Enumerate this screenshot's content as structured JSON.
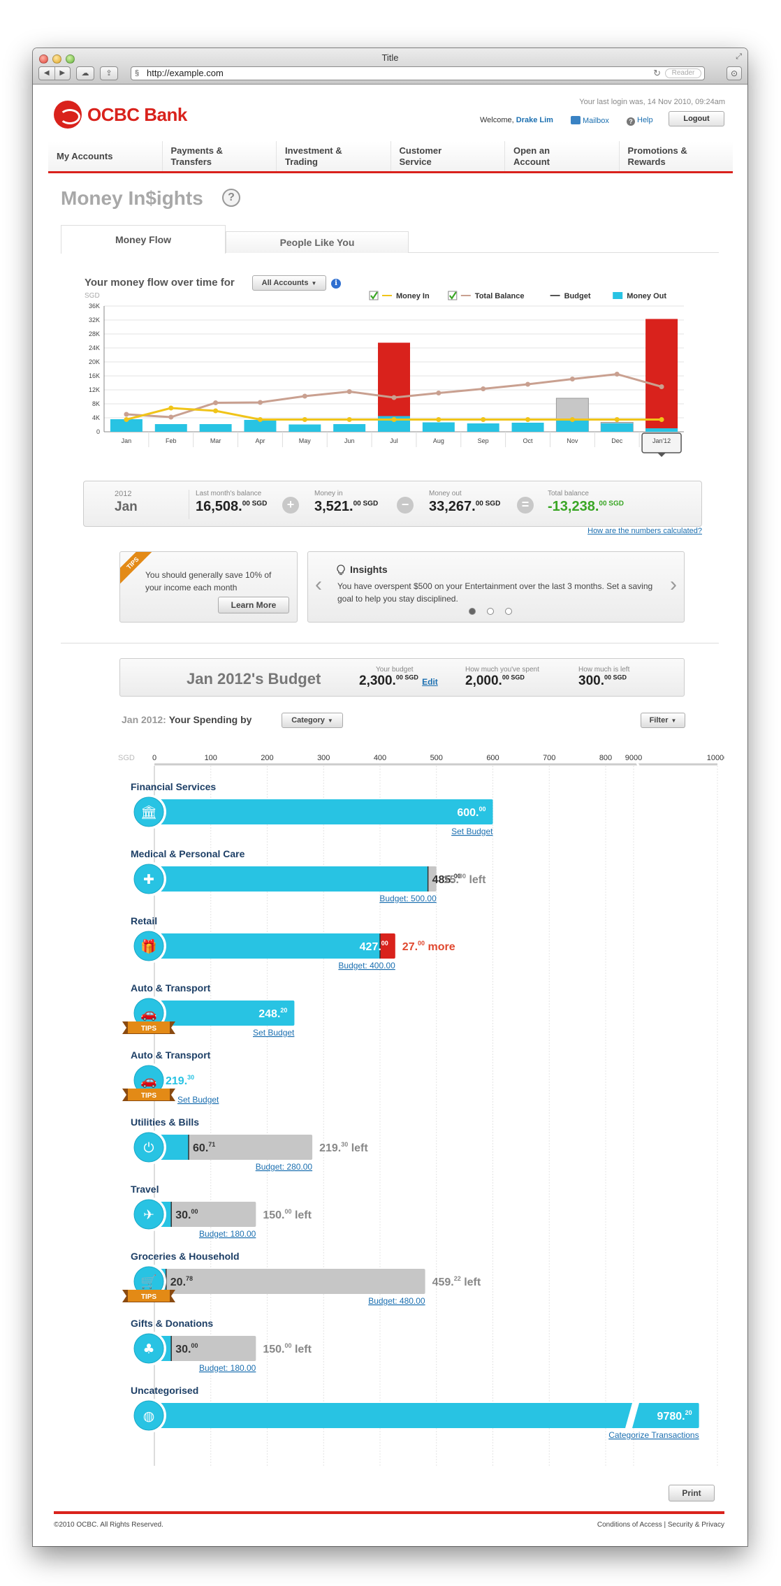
{
  "browser": {
    "title": "Title",
    "url": "http://example.com",
    "reader_label": "Reader"
  },
  "header": {
    "logo_text": "OCBC Bank",
    "last_login": "Your last login was, 14 Nov 2010, 09:24am",
    "welcome": "Welcome,",
    "user_name": "Drake Lim",
    "mailbox": "Mailbox",
    "help": "Help",
    "logout": "Logout"
  },
  "nav": [
    {
      "line1": "My Accounts",
      "line2": ""
    },
    {
      "line1": "Payments &",
      "line2": "Transfers"
    },
    {
      "line1": "Investment &",
      "line2": "Trading"
    },
    {
      "line1": "Customer",
      "line2": "Service"
    },
    {
      "line1": "Open an",
      "line2": "Account"
    },
    {
      "line1": "Promotions &",
      "line2": "Rewards"
    }
  ],
  "page": {
    "title": "Money In$ights",
    "help_symbol": "?",
    "tabs": [
      "Money Flow",
      "People Like You"
    ],
    "active_tab": 0
  },
  "flow": {
    "label": "Your money flow over time for",
    "account_filter": "All Accounts",
    "info_symbol": "i",
    "how_link": "How are the numbers calculated?"
  },
  "chart_data": {
    "type": "bar",
    "ylabel": "SGD",
    "ylim": [
      0,
      36000
    ],
    "yticks": [
      "0",
      "4K",
      "8K",
      "12K",
      "16K",
      "20K",
      "24K",
      "28K",
      "32K",
      "36K"
    ],
    "categories": [
      "Jan",
      "Feb",
      "Mar",
      "Apr",
      "May",
      "Jun",
      "Jul",
      "Aug",
      "Sep",
      "Oct",
      "Nov",
      "Dec",
      "Jan'12"
    ],
    "legend": [
      {
        "name": "Money In",
        "color": "#f0c419",
        "checked": true
      },
      {
        "name": "Total Balance",
        "color": "#c9a090",
        "checked": true
      },
      {
        "name": "Budget",
        "color": "#555555",
        "checked": false
      },
      {
        "name": "Money Out",
        "color": "#28c3e3",
        "checked": false
      }
    ],
    "series": [
      {
        "name": "Money Out",
        "values": [
          3600,
          2200,
          2200,
          3400,
          2100,
          2200,
          4500,
          2700,
          2400,
          2600,
          3300,
          2400,
          1000
        ]
      },
      {
        "name": "Budget",
        "values": [
          null,
          null,
          null,
          null,
          null,
          null,
          null,
          null,
          null,
          null,
          9600,
          2700,
          null
        ]
      },
      {
        "name": "Overspent",
        "values": [
          null,
          null,
          null,
          null,
          null,
          null,
          21000,
          null,
          null,
          null,
          null,
          null,
          31300
        ]
      },
      {
        "name": "Money In",
        "values": [
          3500,
          6800,
          6000,
          3500,
          3500,
          3500,
          3500,
          3500,
          3500,
          3500,
          3500,
          3500,
          3500
        ]
      },
      {
        "name": "Total Balance",
        "values": [
          5000,
          4200,
          8300,
          8400,
          10200,
          11500,
          9800,
          11100,
          12300,
          13600,
          15100,
          16500,
          12900
        ]
      }
    ]
  },
  "summary": {
    "year": "2012",
    "month": "Jan",
    "last_balance_label": "Last month's balance",
    "last_balance": "16,508.",
    "last_balance_cents": "00 SGD",
    "money_in_label": "Money in",
    "money_in": "3,521.",
    "money_in_cents": "00 SGD",
    "money_out_label": "Money out",
    "money_out": "33,267.",
    "money_out_cents": "00 SGD",
    "total_label": "Total balance",
    "total": "-13,238.",
    "total_cents": "00 SGD",
    "op_plus": "+",
    "op_minus": "−",
    "op_equals": "="
  },
  "tips": {
    "ribbon": "TIPS",
    "text": "You should generally save 10% of your income each month",
    "button": "Learn More"
  },
  "insights": {
    "title": "Insights",
    "text": "You have overspent $500 on your Entertainment over the last 3 months. Set a saving goal to help you stay disciplined.",
    "prev": "‹",
    "next": "›"
  },
  "budget": {
    "title": "Jan 2012's Budget",
    "your_budget_label": "Your budget",
    "your_budget": "2,300.",
    "your_budget_cents": "00 SGD",
    "edit": "Edit",
    "spent_label": "How much you've spent",
    "spent": "2,000.",
    "spent_cents": "00 SGD",
    "left_label": "How much is left",
    "left": "300.",
    "left_cents": "00 SGD"
  },
  "spending": {
    "prefix": "Jan 2012:",
    "label": "Your Spending by",
    "group_by": "Category",
    "filter": "Filter",
    "axis_unit": "SGD",
    "axis_ticks": [
      "0",
      "100",
      "200",
      "300",
      "400",
      "500",
      "600",
      "700",
      "800",
      "9000",
      "10000"
    ],
    "tips_label": "TIPS",
    "categories": [
      {
        "name": "Financial Services",
        "icon": "bank-icon",
        "spent": 600,
        "spent_text": "600.",
        "cents": "00",
        "budget": null,
        "link": "Set Budget",
        "note": "",
        "note_type": ""
      },
      {
        "name": "Medical & Personal Care",
        "icon": "medical-kit-icon",
        "spent": 485,
        "spent_text": "485.",
        "cents": "00",
        "budget": 500,
        "link": "Budget: 500.00",
        "note": "15.",
        "note_cents": "00",
        "note_suffix": " left",
        "note_type": "left"
      },
      {
        "name": "Retail",
        "icon": "gift-icon",
        "spent": 427,
        "spent_text": "427.",
        "cents": "00",
        "budget": 400,
        "link": "Budget: 400.00",
        "note": "27.",
        "note_cents": "00",
        "note_suffix": " more",
        "note_type": "more"
      },
      {
        "name": "Auto & Transport",
        "icon": "car-icon",
        "tips": true,
        "spent": 248.2,
        "spent_text": "248.",
        "cents": "20",
        "budget": null,
        "link": "Set Budget",
        "note": "",
        "note_type": ""
      },
      {
        "name": "Auto & Transport",
        "icon": "car-icon",
        "tips": true,
        "spent": 0,
        "spent_text": "219.",
        "cents": "30",
        "budget": null,
        "link": "Set Budget",
        "note": "",
        "note_type": "outside"
      },
      {
        "name": "Utilities & Bills",
        "icon": "plug-icon",
        "spent": 60.71,
        "spent_text": "60.",
        "cents": "71",
        "budget": 280,
        "link": "Budget: 280.00",
        "note": "219.",
        "note_cents": "30",
        "note_suffix": " left",
        "note_type": "left"
      },
      {
        "name": "Travel",
        "icon": "airplane-icon",
        "spent": 30,
        "spent_text": "30.",
        "cents": "00",
        "budget": 180,
        "link": "Budget: 180.00",
        "note": "150.",
        "note_cents": "00",
        "note_suffix": " left",
        "note_type": "left"
      },
      {
        "name": "Groceries & Household",
        "icon": "cart-icon",
        "tips": true,
        "spent": 20.78,
        "spent_text": "20.",
        "cents": "78",
        "budget": 480,
        "link": "Budget: 480.00",
        "note": "459.",
        "note_cents": "22",
        "note_suffix": " left",
        "note_type": "left"
      },
      {
        "name": "Gifts & Donations",
        "icon": "clover-icon",
        "spent": 30,
        "spent_text": "30.",
        "cents": "00",
        "budget": 180,
        "link": "Budget: 180.00",
        "note": "150.",
        "note_cents": "00",
        "note_suffix": " left",
        "note_type": "left"
      },
      {
        "name": "Uncategorised",
        "icon": "globe-icon",
        "spent": 9780.2,
        "spent_text": "9780.",
        "cents": "20",
        "budget": null,
        "link": "Categorize Transactions",
        "note": "",
        "note_type": ""
      }
    ]
  },
  "footer": {
    "print": "Print",
    "copyright": "©2010 OCBC. All Rights Reserved.",
    "links": "Conditions of Access | Security & Privacy"
  },
  "colors": {
    "brand_red": "#d9221c",
    "money_out": "#28c3e3",
    "money_in": "#f0c419",
    "balance": "#c9a090",
    "over": "#d9221c",
    "remaining": "#c6c6c6",
    "positive": "#3aa625",
    "link": "#1b6fb0"
  }
}
